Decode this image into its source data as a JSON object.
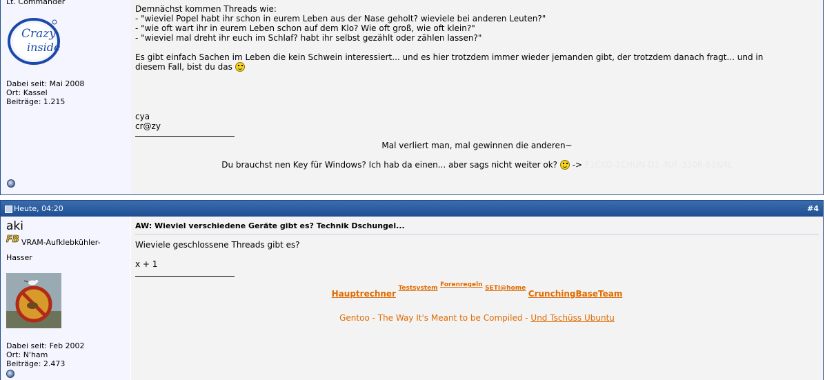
{
  "post1": {
    "user": {
      "rank": "Lt. Commander",
      "avatar_text": [
        "Crazy",
        "inside"
      ],
      "joined": "Dabei seit: Mai 2008",
      "location": "Ort: Kassel",
      "posts": "Beiträge: 1.215"
    },
    "message": {
      "lines": [
        "Demnächst kommen Threads wie:",
        "- \"wieviel Popel habt ihr schon in eurem Leben aus der Nase geholt? wieviele bei anderen Leuten?\"",
        "- \"wie oft wart ihr in eurem Leben schon auf dem Klo? Wie oft groß, wie oft klein?\"",
        "- \"wieviel mal dreht ihr euch im Schlaf? habt ihr selbst gezählt oder zählen lassen?\""
      ],
      "para1": "Es gibt einfach Sachen im Leben die kein Schwein interessiert... und es hier trotzdem immer wieder jemanden gibt, der trotzdem danach fragt... und in",
      "para2": "diesem Fall, bist du das",
      "sign1": "cya",
      "sign2": "cr@zy"
    },
    "signature": {
      "quote": "Mal verliert man, mal gewinnen die anderen~",
      "key_prefix": "Du brauchst nen Key für Windows? Ich hab da einen... aber sags nicht weiter ok?",
      "arrow": "->",
      "key": "F1CKO-1CHUN-D1-4UF-350R-61N4L"
    }
  },
  "post2": {
    "header": {
      "date": "Heute, 04:20",
      "number": "#4"
    },
    "user": {
      "name": "aki",
      "badge": "FB",
      "title_line1": "VRAM-Aufklebkühler-",
      "title_line2": "Hasser",
      "joined": "Dabei seit: Feb 2002",
      "location": "Ort: N'ham",
      "posts": "Beiträge: 2.473"
    },
    "message": {
      "title": "AW: Wieviel verschiedene Geräte gibt es? Technik Dschungel...",
      "line1": "Wieviele geschlossene Threads gibt es?",
      "line2": "x + 1"
    },
    "signature": {
      "links": [
        "Hauptrechner",
        "Testsystem",
        "Forenregeln",
        "SETI@home",
        "CrunchingBaseTeam"
      ],
      "gentoo": "Gentoo - The Way It's Meant to be Compiled -",
      "ubuntu_link": "Und Tschüss Ubuntu"
    }
  },
  "colors": {
    "header_blue": "#1f4f92",
    "link_orange": "#e06b00",
    "message_bg": "#f3f3f3",
    "sidebar_bg": "#f5f5ff"
  }
}
